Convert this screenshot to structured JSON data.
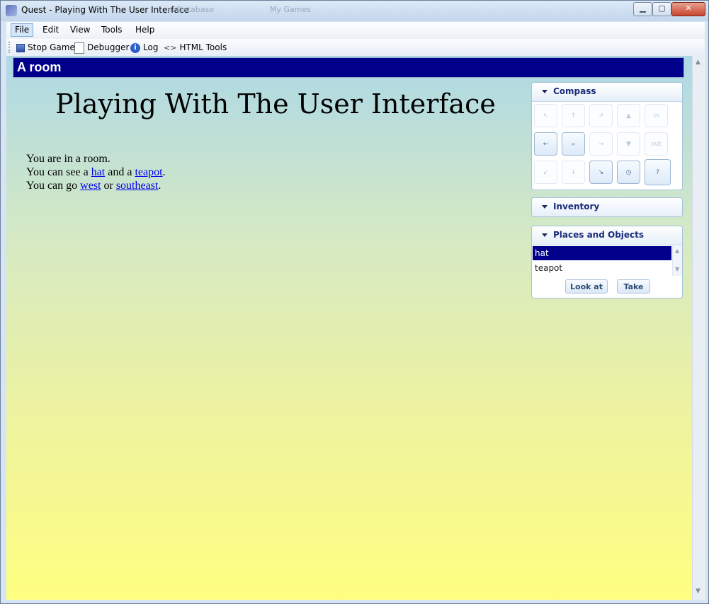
{
  "window": {
    "title": "Quest - Playing With The User Interface",
    "ghost_tab_1": "nl Database",
    "ghost_tab_2": "My Games",
    "minimize": "▁",
    "maximize": "▢",
    "close": "✕"
  },
  "menu": [
    "File",
    "Edit",
    "View",
    "Tools",
    "Help"
  ],
  "toolbar": {
    "stop_game": "Stop Game",
    "debugger": "Debugger",
    "log": "Log",
    "html_tools": "HTML Tools"
  },
  "room": {
    "header": "A room",
    "game_title": "Playing With The User Interface",
    "line1": "You are in a room.",
    "line2_prefix": "You can see a ",
    "line2_obj1": "hat",
    "line2_mid": " and a ",
    "line2_obj2": "teapot",
    "line2_suffix": ".",
    "line3_prefix": "You can go ",
    "line3_exit1": "west",
    "line3_mid": " or ",
    "line3_exit2": "southeast",
    "line3_suffix": "."
  },
  "compass": {
    "title": "Compass",
    "nw": "↖",
    "n": "↑",
    "ne": "↗",
    "up": "▲",
    "in": "in",
    "w": "←",
    "look": "⌕",
    "e": "→",
    "down": "▼",
    "out": "out",
    "sw": "↙",
    "s": "↓",
    "se": "↘",
    "wait": "◷",
    "help": "?"
  },
  "inventory": {
    "title": "Inventory"
  },
  "places": {
    "title": "Places and Objects",
    "items": [
      "hat",
      "teapot"
    ],
    "look_at": "Look at",
    "take": "Take"
  }
}
